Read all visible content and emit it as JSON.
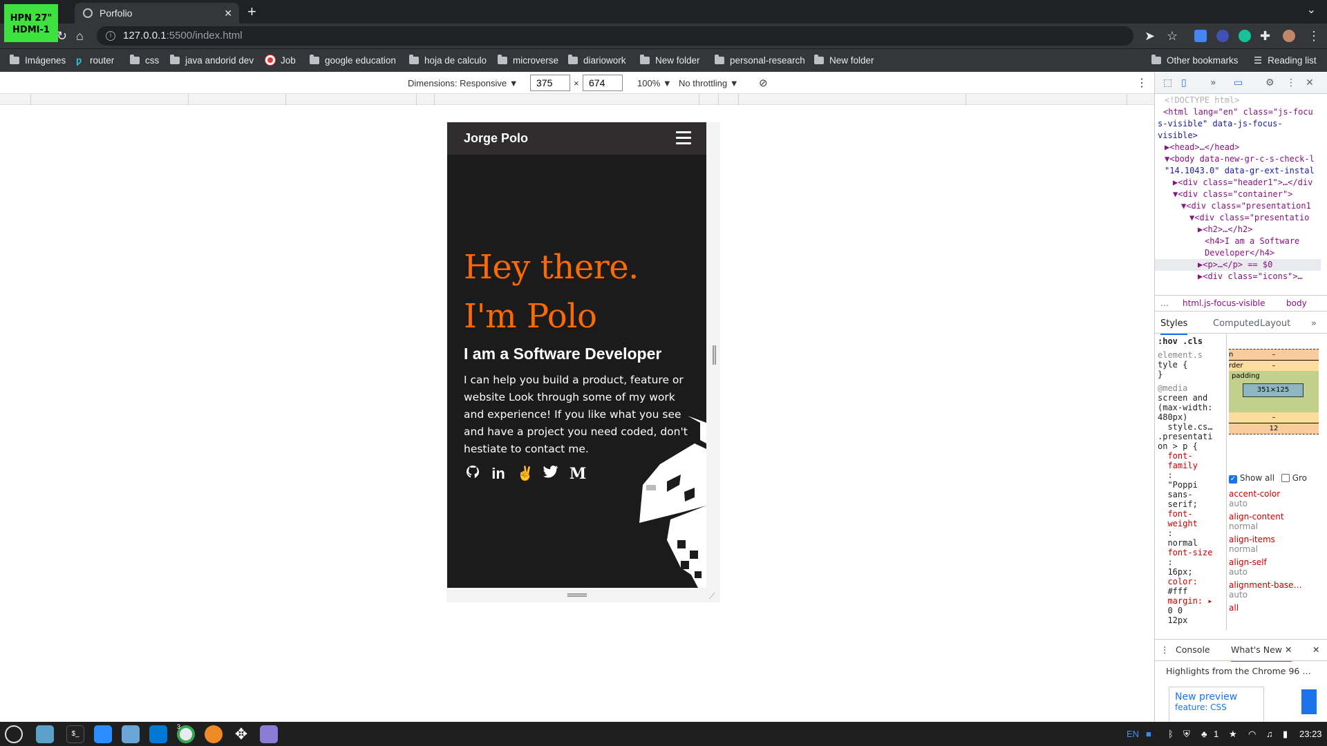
{
  "browser": {
    "badge_line1": "HPN 27\"",
    "badge_line2": "HDMI-1",
    "tab_title": "Porfolio",
    "url_host": "127.0.0.1",
    "url_path": ":5500/index.html",
    "bookmarks": [
      "Imágenes",
      "router",
      "css",
      "java andorid dev",
      "Job",
      "google education",
      "hoja de calculo",
      "microverse",
      "diariowork",
      "New folder",
      "personal-research",
      "New folder"
    ],
    "other_bookmarks": "Other bookmarks",
    "reading_list": "Reading list"
  },
  "device_toolbar": {
    "dimensions_label": "Dimensions: Responsive",
    "width": "375",
    "height": "674",
    "times": "×",
    "zoom": "100%",
    "throttling": "No throttling"
  },
  "page": {
    "brand": "Jorge Polo",
    "hello_line1": "Hey there.",
    "hello_line2": "I'm Polo",
    "subtitle": "I am a Software Developer",
    "bio": "I can help you build a product, feature or website Look through some of my work and experience! If you like what you see and have a project you need coded, don't hestiate to contact me.",
    "social": [
      "github-icon",
      "linkedin-icon",
      "angellist-icon",
      "twitter-icon",
      "medium-icon"
    ],
    "medium_glyph": "M",
    "accent_color": "#ff6a00"
  },
  "devtools": {
    "dom_lines": [
      "<!DOCTYPE html>",
      "<html lang=\"en\" class=\"js-focu",
      "s-visible\" data-js-focus-",
      "visible>",
      "▶<head>…</head>",
      "▼<body data-new-gr-c-s-check-l",
      "\"14.1043.0\" data-gr-ext-instal",
      "▶<div class=\"header1\">…</div",
      "▼<div class=\"container\">",
      "▼<div class=\"presentation1",
      "▼<div class=\"presentatio",
      "▶<h2>…</h2>",
      "<h4>I am a Software",
      "Developer</h4>",
      "▶<p>…</p> == $0",
      "▶<div class=\"icons\">…"
    ],
    "crumb_html": "html.js-focus-visible",
    "crumb_body": "body",
    "tabs": [
      "Styles",
      "Computed",
      "Layout"
    ],
    "filters": [
      ":hov",
      ".cls"
    ],
    "styles_lines": [
      "element.s",
      "tyle {",
      "}",
      "@media",
      "screen and",
      "(max-width:",
      "480px)",
      "  style.cs…",
      ".presentati",
      "on > p {",
      "  font-",
      "  family",
      "  :",
      "  \"Poppi",
      "  sans-",
      "  serif;",
      "  font-",
      "  weight",
      "  :",
      "  normal",
      "  font-size",
      "  :",
      "  16px;",
      "  color:",
      "  #fff",
      "  margin: ▸",
      "  0 0",
      "  12px"
    ],
    "box": {
      "margin_label": "n",
      "border_label": "rder",
      "padding_label": "padding",
      "content": "351×125",
      "dash": "–",
      "bottom": "12"
    },
    "show_all": "Show all",
    "group": "Gro",
    "computed": [
      {
        "p": "accent-color",
        "v": "auto"
      },
      {
        "p": "align-content",
        "v": "normal"
      },
      {
        "p": "align-items",
        "v": "normal"
      },
      {
        "p": "align-self",
        "v": "auto"
      },
      {
        "p": "alignment-base…",
        "v": "auto"
      },
      {
        "p": "all",
        "v": ""
      }
    ],
    "drawer_tabs": [
      "Console",
      "What's New"
    ],
    "drawer_highlight": "Highlights from the Chrome 96 …",
    "new_preview": "New preview",
    "feature": "feature: CSS"
  },
  "taskbar": {
    "lang": "EN",
    "time": "23:23",
    "chrome_badge": "3",
    "tray_count": "1"
  }
}
